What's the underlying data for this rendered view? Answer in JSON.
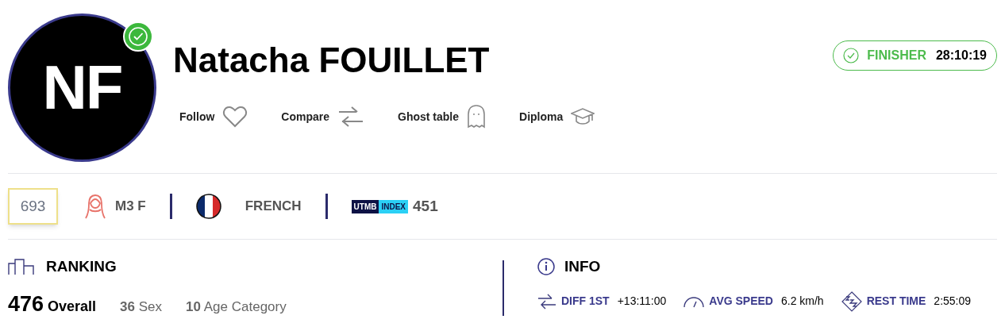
{
  "runner": {
    "initials": "NF",
    "verified": true,
    "name": "Natacha FOUILLET"
  },
  "status": {
    "label": "FINISHER",
    "time": "28:10:19"
  },
  "actions": [
    {
      "kind": "follow",
      "label": "Follow"
    },
    {
      "kind": "compare",
      "label": "Compare"
    },
    {
      "kind": "ghost",
      "label": "Ghost table"
    },
    {
      "kind": "diploma",
      "label": "Diploma"
    }
  ],
  "bib": "693",
  "category": "M3 F",
  "nationality": "FRENCH",
  "utmb_index": {
    "logo_left": "UTMB",
    "logo_right": "INDEX",
    "value": "451"
  },
  "ranking": {
    "title": "RANKING",
    "overall": {
      "value": "476",
      "label": "Overall"
    },
    "stats": [
      "**36** Sex",
      "**10** Age Category"
    ]
  },
  "info": {
    "title": "INFO",
    "items": [
      {
        "kind": "diff",
        "label": "DIFF 1ST",
        "value": "+13:11:00"
      },
      {
        "kind": "speed",
        "label": "AVG SPEED",
        "value": "6.2 km/h"
      },
      {
        "kind": "rest",
        "label": "REST TIME",
        "value": "2:55:09"
      }
    ]
  }
}
